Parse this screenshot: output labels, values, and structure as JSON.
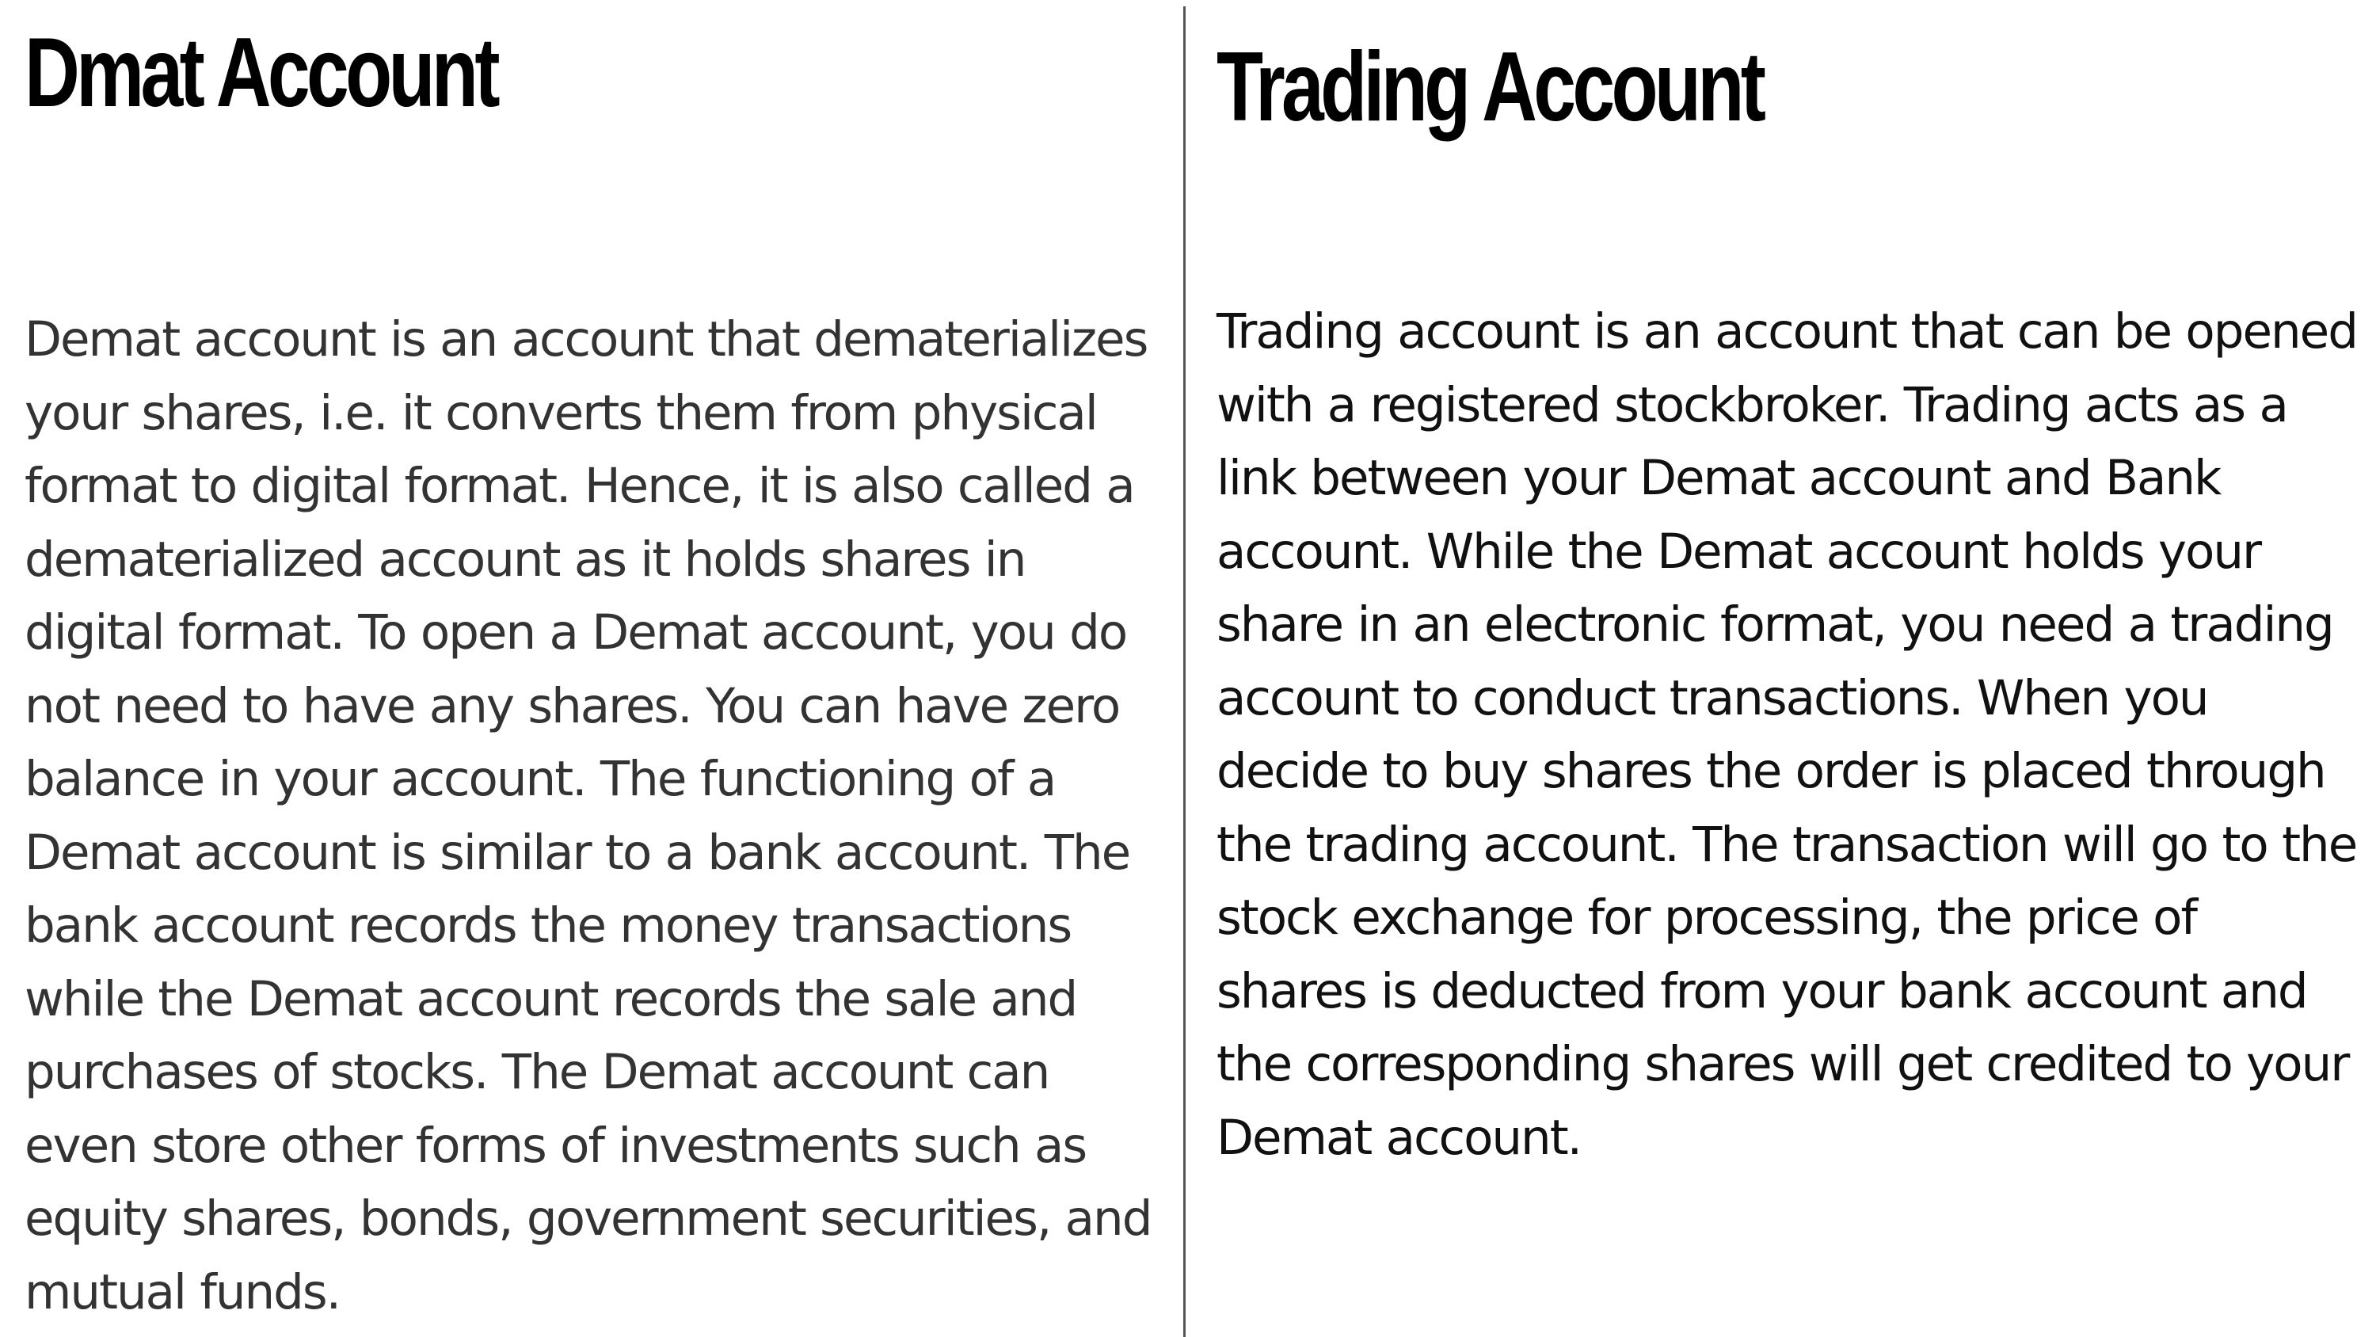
{
  "left_section": {
    "title": "Dmat Account",
    "body": "Demat account is an account that dematerializes your shares, i.e. it converts them from physical format to digital format. Hence, it is also called a dematerialized account as it holds shares in digital format. To open a Demat account, you do not need to have any shares. You can have zero balance in your account. The functioning of a Demat account is similar to a bank account. The bank account records the money transactions while the Demat account records the sale and purchases of stocks. The Demat account can even store other forms of investments such as equity shares, bonds, government securities, and mutual funds."
  },
  "right_section": {
    "title": "Trading Account",
    "body": "Trading account is an account that can be opened with a registered stockbroker. Trading acts as a link between your Demat account and Bank account. While the Demat account holds your share in an electronic format, you need a trading account to conduct transactions. When you decide to buy shares the order is placed through the trading account. The transaction will go to the stock exchange for processing, the price of shares is deducted from your bank account and the corresponding shares will get credited to your Demat account."
  },
  "colors": {
    "heading": "#000000",
    "left_body": "#333333",
    "right_body": "#111111",
    "divider": "#555555",
    "background": "#ffffff"
  }
}
